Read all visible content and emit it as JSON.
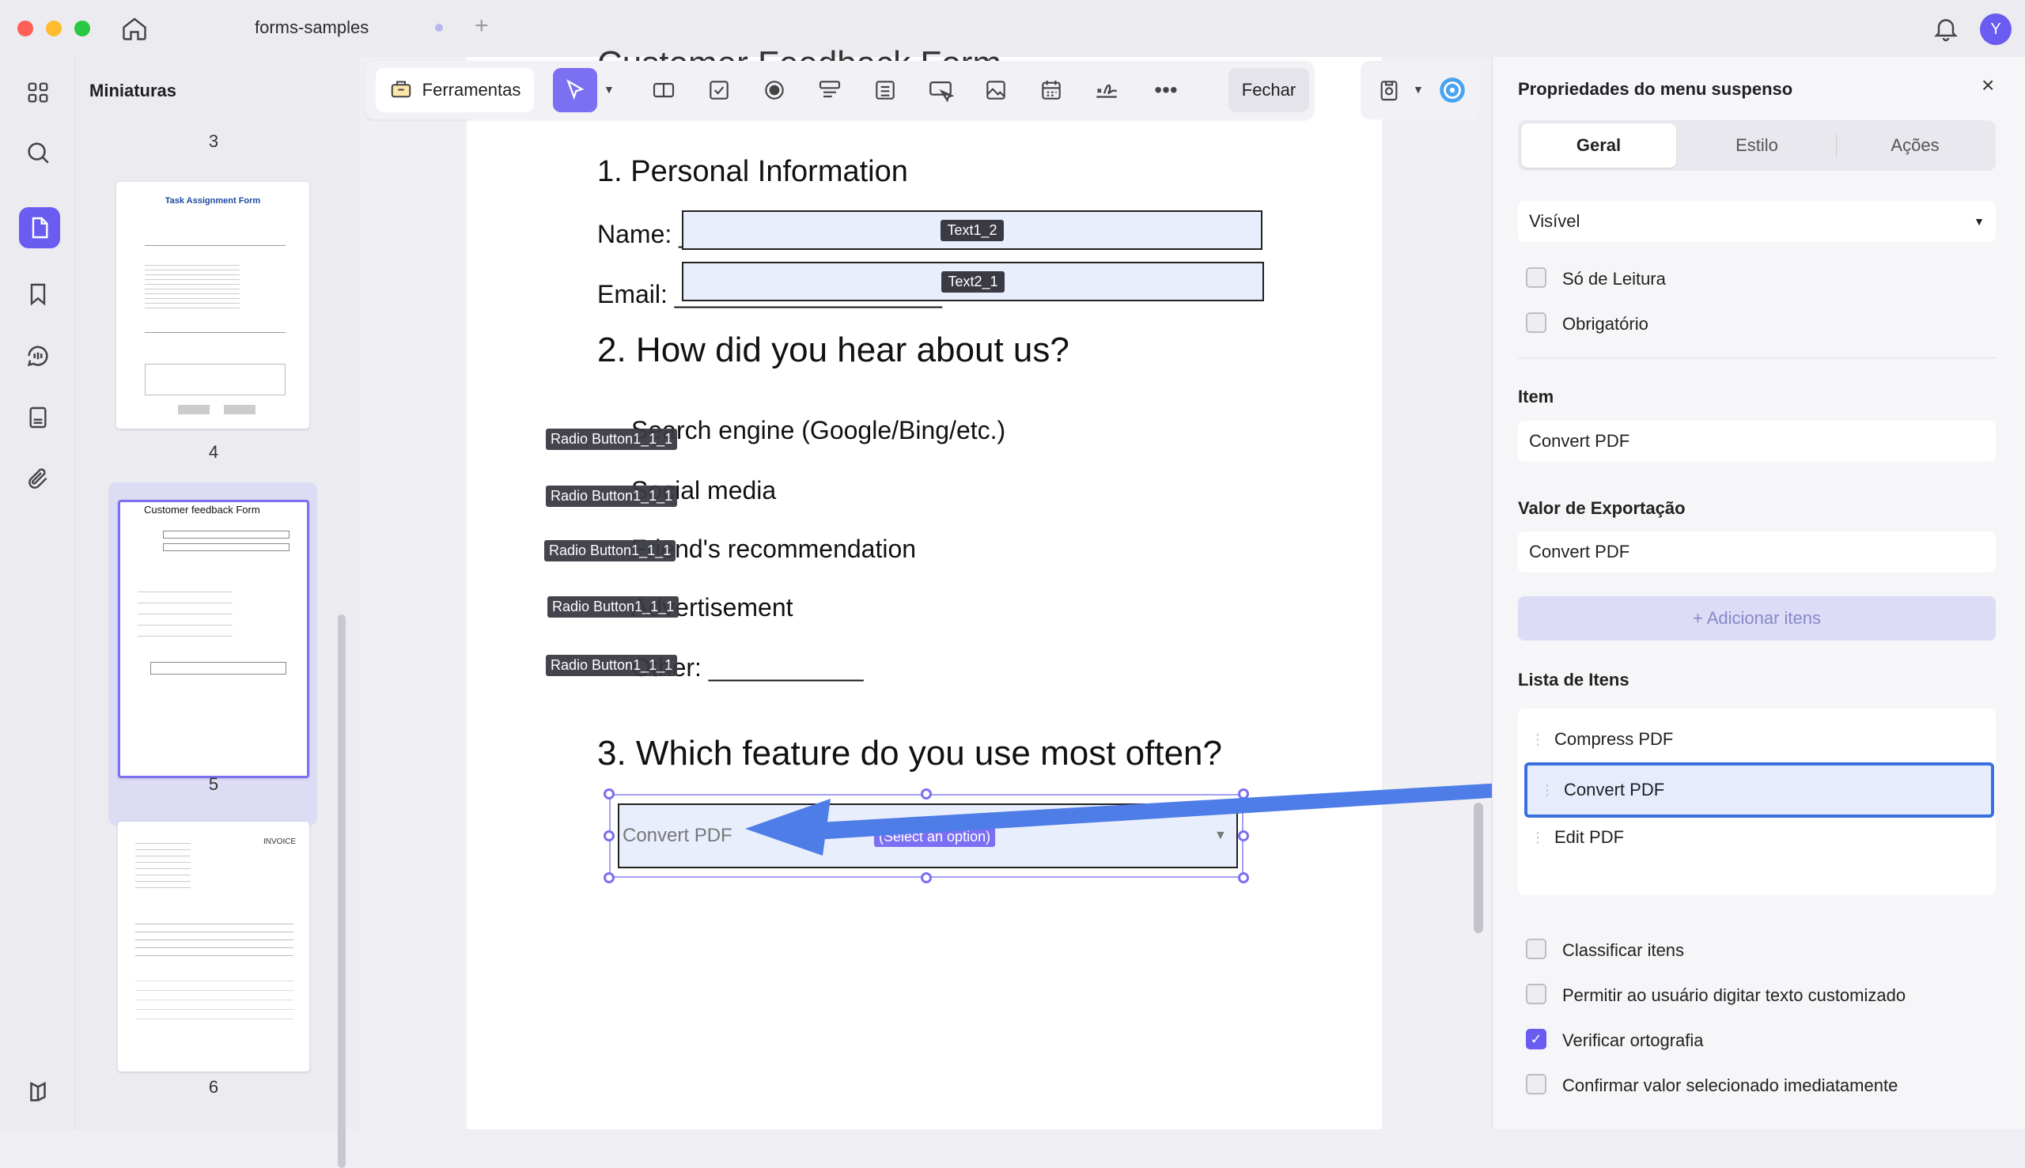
{
  "window": {
    "tab_title": "forms-samples",
    "new_tab": "+",
    "avatar": "Y"
  },
  "colors": {
    "accent": "#6a5cf0",
    "field_fill": "#e8eefc",
    "arrow": "#4f7de8"
  },
  "sidebar": {
    "icons": [
      "grid-icon",
      "search-icon",
      "pages-icon",
      "bookmark-icon",
      "comment-icon",
      "form-icon",
      "attachment-icon",
      "layers-icon"
    ]
  },
  "thumbnails": {
    "title": "Miniaturas",
    "pages": [
      {
        "num": "3"
      },
      {
        "num": "4",
        "heading": "Task Assignment Form"
      },
      {
        "num": "5",
        "heading": "Customer feedback Form"
      },
      {
        "num": "6",
        "heading": "INVOICE"
      }
    ]
  },
  "toolbar": {
    "tools_label": "Ferramentas",
    "close_label": "Fechar"
  },
  "form": {
    "title_partial": "Customer Feedback Form",
    "s1": "1. Personal Information",
    "name_label": "Name: _",
    "email_label": "Email: ___________________",
    "text1_tag": "Text1_2",
    "text2_tag": "Text2_1",
    "s2": "2. How did you hear about us?",
    "options": [
      {
        "text": "Search engine (Google/Bing/etc.)",
        "tag": "Radio Button1_1_1"
      },
      {
        "text": "Social media",
        "tag": "Radio Button1_1_1"
      },
      {
        "text": "Friend's recommendation",
        "tag": "Radio Button1_1_1"
      },
      {
        "text": "Advertisement",
        "tag": "Radio Button1_1_1"
      },
      {
        "text": "Other: ___________",
        "tag": "Radio Button1_1_1"
      }
    ],
    "s3": "3. Which feature do you use most often?",
    "dropdown_value": "Convert PDF",
    "dropdown_placeholder": "(Select an option)"
  },
  "panel": {
    "title": "Propriedades do menu suspenso",
    "tabs": [
      "Geral",
      "Estilo",
      "Ações"
    ],
    "visibility": "Visível",
    "readonly": "Só de Leitura",
    "required": "Obrigatório",
    "item_label": "Item",
    "item_value": "Convert PDF",
    "export_label": "Valor de Exportação",
    "export_value": "Convert PDF",
    "add_items": "+ Adicionar itens",
    "list_label": "Lista de Itens",
    "list_items": [
      "Compress PDF",
      "Convert PDF",
      "Edit PDF"
    ],
    "options": [
      {
        "label": "Classificar itens",
        "checked": false
      },
      {
        "label": "Permitir ao usuário digitar texto customizado",
        "checked": false
      },
      {
        "label": "Verificar ortografia",
        "checked": true
      },
      {
        "label": "Confirmar valor selecionado imediatamente",
        "checked": false
      }
    ]
  }
}
